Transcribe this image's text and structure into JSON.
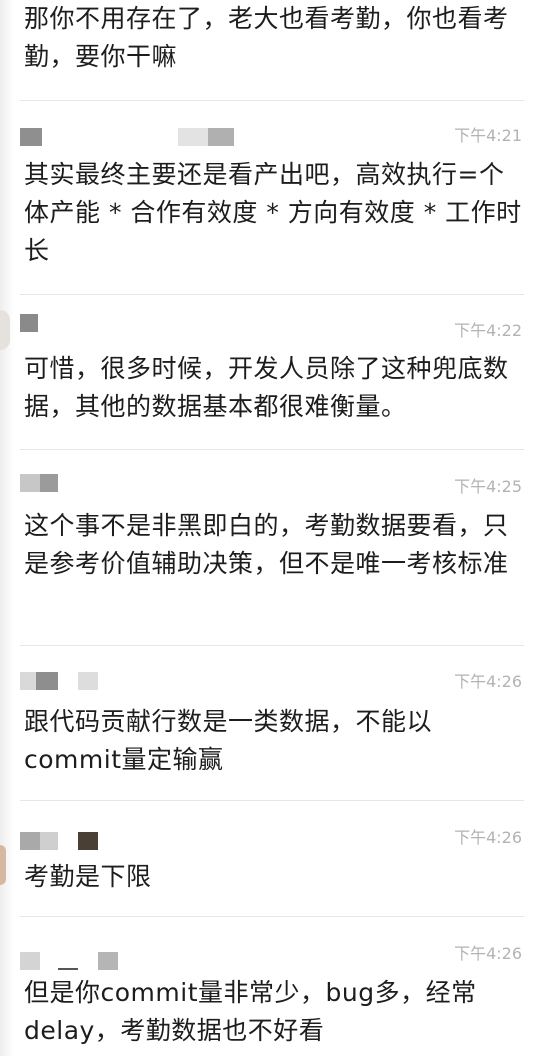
{
  "messages": [
    {
      "text": "那你不用存在了，老大也看考勤，你也看考勤，要你干嘛"
    },
    {
      "time": "下午4:21",
      "text": "其实最终主要还是看产出吧，高效执行=个体产能 * 合作有效度 * 方向有效度 * 工作时长"
    },
    {
      "time": "下午4:22",
      "text": "可惜，很多时候，开发人员除了这种兜底数据，其他的数据基本都很难衡量。"
    },
    {
      "time": "下午4:25",
      "text": "这个事不是非黑即白的，考勤数据要看，只是参考价值辅助决策，但不是唯一考核标准"
    },
    {
      "time": "下午4:26",
      "text": "跟代码贡献行数是一类数据，不能以commit量定输赢"
    },
    {
      "time": "下午4:26",
      "text": "考勤是下限"
    },
    {
      "time": "下午4:26",
      "text": "但是你commit量非常少，bug多，经常delay，考勤数据也不好看"
    }
  ],
  "colors": {
    "text": "#1d1d1d",
    "timestamp": "#b3b3b3",
    "separator": "#e6e6e6",
    "redacted_light": "#d6d6d6",
    "redacted_mid": "#9a9a9a",
    "redacted_dark": "#4a3f35"
  }
}
